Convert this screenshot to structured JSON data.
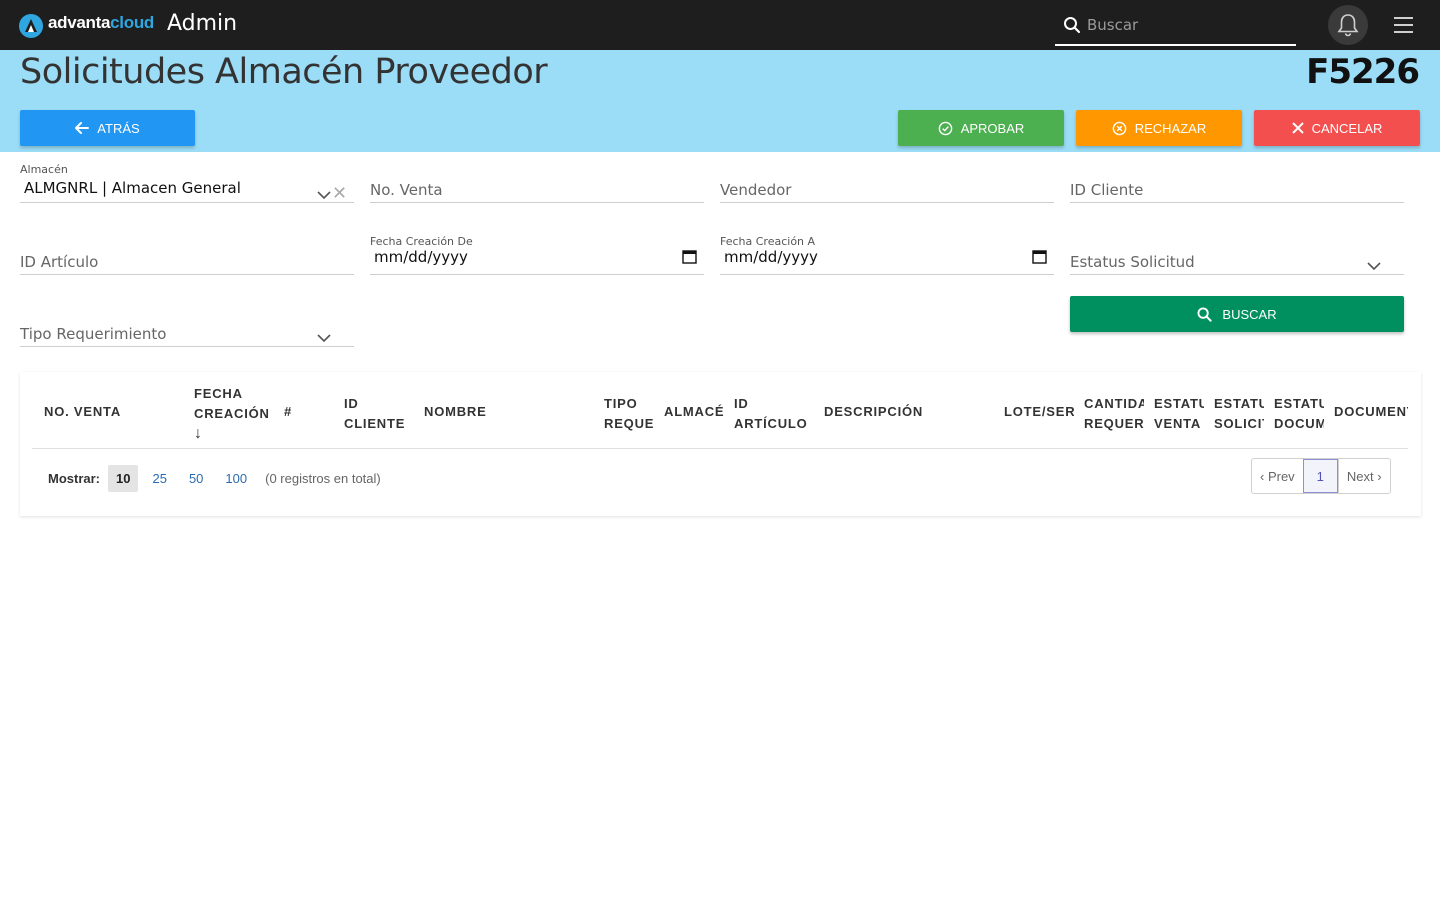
{
  "topbar": {
    "brand_part1": "advanta",
    "brand_part2": "cloud",
    "section": "Admin",
    "search_placeholder": "Buscar",
    "brand_color": "#2fa6e0"
  },
  "header": {
    "title": "Solicitudes Almacén Proveedor",
    "code": "F5226",
    "back_label": "ATRÁS",
    "approve_label": "APROBAR",
    "reject_label": "RECHAZAR",
    "cancel_label": "CANCELAR",
    "band_color": "#9bdcf6"
  },
  "filters": {
    "almacen_label": "Almacén",
    "almacen_value": "ALMGNRL | Almacen General",
    "no_venta": "No. Venta",
    "vendedor": "Vendedor",
    "id_cliente": "ID Cliente",
    "id_articulo": "ID Artículo",
    "fecha_de_label": "Fecha Creación De",
    "fecha_de_value": "mm/dd/yyyy",
    "fecha_a_label": "Fecha Creación A",
    "fecha_a_value": "mm/dd/yyyy",
    "estatus": "Estatus Solicitud",
    "tipo_req": "Tipo Requerimiento",
    "search_label": "BUSCAR"
  },
  "table": {
    "columns": [
      {
        "line1": "NO. VENTA",
        "line2": ""
      },
      {
        "line1": "FECHA",
        "line2": "CREACIÓN",
        "sort": "↓"
      },
      {
        "line1": "#",
        "line2": ""
      },
      {
        "line1": "ID",
        "line2": "CLIENTE"
      },
      {
        "line1": "NOMBRE",
        "line2": ""
      },
      {
        "line1": "TIPO",
        "line2": "REQUE"
      },
      {
        "line1": "ALMACÉN",
        "line2": ""
      },
      {
        "line1": "ID",
        "line2": "ARTÍCULO"
      },
      {
        "line1": "DESCRIPCIÓN",
        "line2": ""
      },
      {
        "line1": "LOTE/SERIE",
        "line2": ""
      },
      {
        "line1": "CANTIDAD",
        "line2": "REQUERIDA"
      },
      {
        "line1": "ESTATUS",
        "line2": "VENTA"
      },
      {
        "line1": "ESTATUS",
        "line2": "SOLICITUD"
      },
      {
        "line1": "ESTATUS",
        "line2": "DOCUMENTO"
      },
      {
        "line1": "DOCUMENTO",
        "line2": ""
      }
    ],
    "rows": []
  },
  "pager": {
    "show_label": "Mostrar:",
    "page_sizes": [
      "10",
      "25",
      "50",
      "100"
    ],
    "selected_size": "10",
    "total_text": "(0 registros en total)",
    "prev": "‹ Prev",
    "current": "1",
    "next": "Next ›"
  }
}
